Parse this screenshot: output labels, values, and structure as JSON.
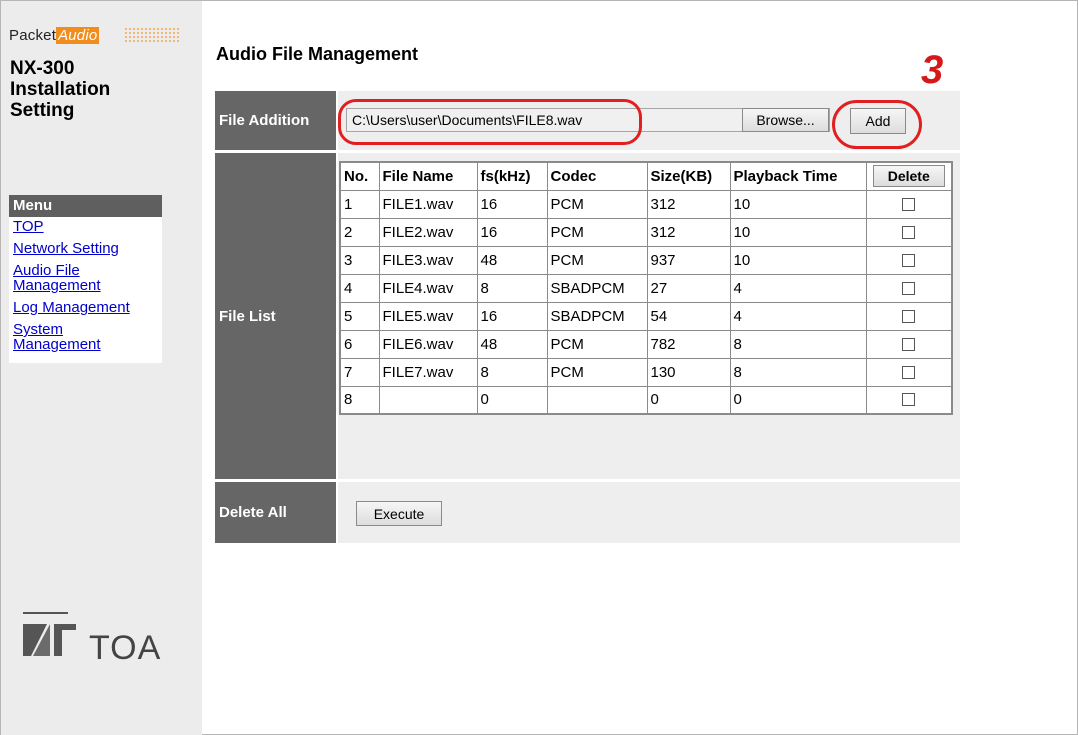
{
  "brand": {
    "packet": "Packet",
    "audio": "Audio",
    "company": "TOA"
  },
  "product": {
    "line1": "NX-300",
    "line2": "Installation",
    "line3": "Setting"
  },
  "menu": {
    "header": "Menu",
    "items": [
      {
        "label": "TOP"
      },
      {
        "label": "Network Setting"
      },
      {
        "label": "Audio File Management"
      },
      {
        "label": "Log Management"
      },
      {
        "label": "System Management"
      }
    ]
  },
  "page": {
    "title": "Audio File Management",
    "step_number": "3"
  },
  "file_addition": {
    "label": "File Addition",
    "path_value": "C:\\Users\\user\\Documents\\FILE8.wav",
    "browse_label": "Browse...",
    "add_label": "Add"
  },
  "file_list": {
    "label": "File List",
    "columns": [
      "No.",
      "File Name",
      "fs(kHz)",
      "Codec",
      "Size(KB)",
      "Playback Time"
    ],
    "delete_label": "Delete",
    "rows": [
      [
        "1",
        "FILE1.wav",
        "16",
        "PCM",
        "312",
        "10"
      ],
      [
        "2",
        "FILE2.wav",
        "16",
        "PCM",
        "312",
        "10"
      ],
      [
        "3",
        "FILE3.wav",
        "48",
        "PCM",
        "937",
        "10"
      ],
      [
        "4",
        "FILE4.wav",
        "8",
        "SBADPCM",
        "27",
        "4"
      ],
      [
        "5",
        "FILE5.wav",
        "16",
        "SBADPCM",
        "54",
        "4"
      ],
      [
        "6",
        "FILE6.wav",
        "48",
        "PCM",
        "782",
        "8"
      ],
      [
        "7",
        "FILE7.wav",
        "8",
        "PCM",
        "130",
        "8"
      ],
      [
        "8",
        "",
        "0",
        "",
        "0",
        "0"
      ]
    ]
  },
  "delete_all": {
    "label": "Delete All",
    "execute_label": "Execute"
  }
}
